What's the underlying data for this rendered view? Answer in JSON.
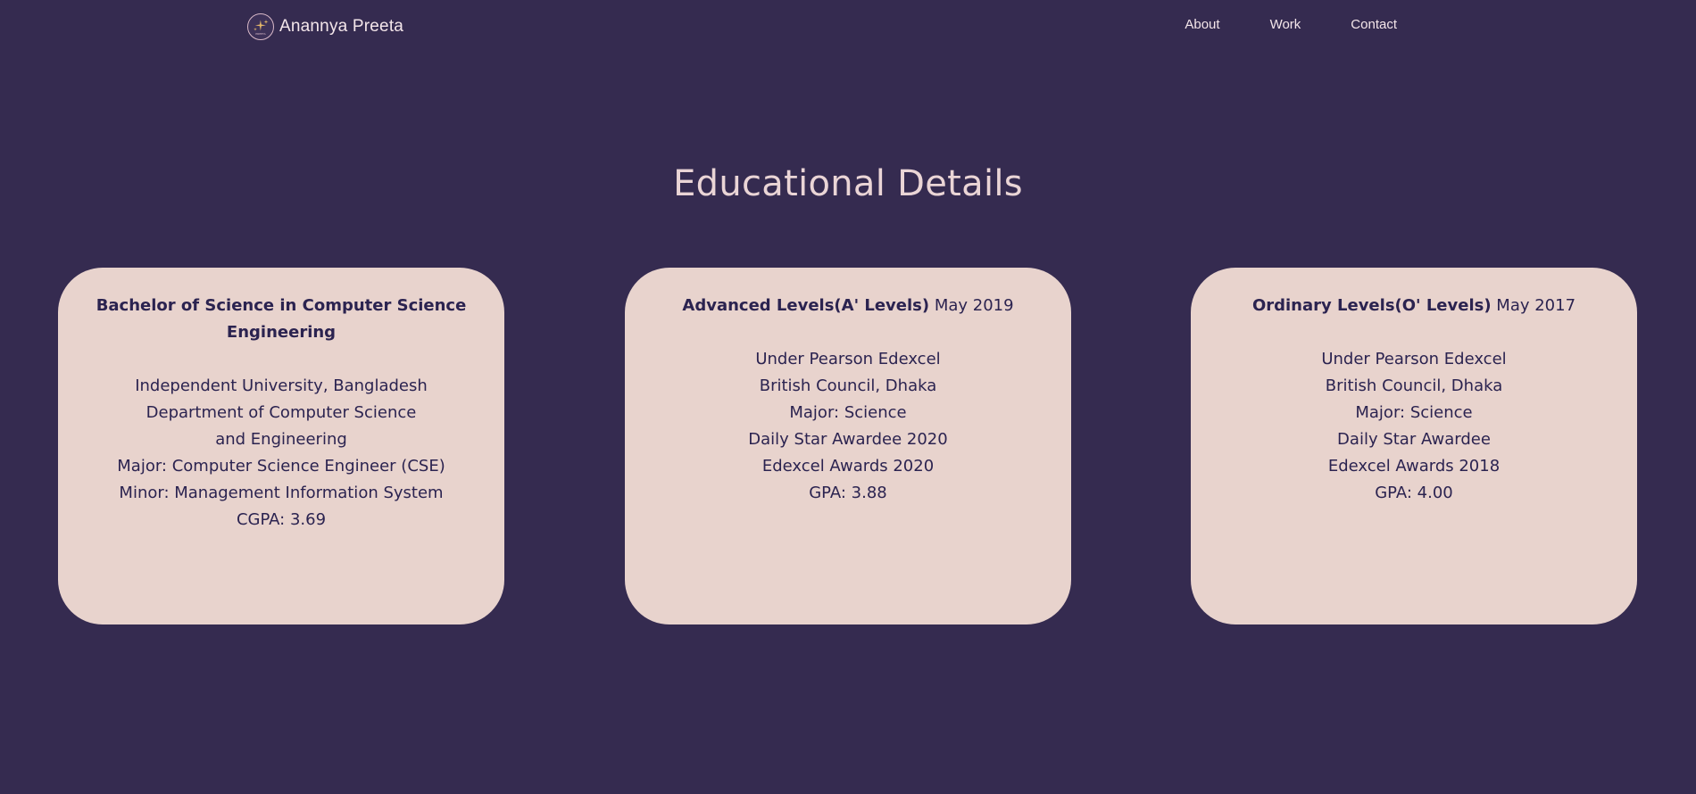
{
  "nav": {
    "brand_name": "Anannya Preeta",
    "logo_text": "PREETA",
    "links": [
      "About",
      "Work",
      "Contact"
    ]
  },
  "section": {
    "title": "Educational Details"
  },
  "cards": [
    {
      "title": "Bachelor of Science in Computer Science Engineering",
      "date": "",
      "lines": [
        "Independent University, Bangladesh",
        "Department of Computer Science",
        "and Engineering",
        "Major: Computer Science Engineer (CSE)",
        "Minor: Management Information System",
        "CGPA: 3.69"
      ]
    },
    {
      "title": "Advanced Levels(A' Levels)",
      "date": "May 2019",
      "lines": [
        "Under Pearson Edexcel",
        "British Council, Dhaka",
        "Major: Science",
        "Daily Star Awardee 2020",
        "Edexcel Awards 2020",
        "GPA: 3.88"
      ]
    },
    {
      "title": "Ordinary Levels(O' Levels)",
      "date": "May 2017",
      "lines": [
        "Under Pearson Edexcel",
        "British Council, Dhaka",
        "Major: Science",
        "Daily Star Awardee",
        "Edexcel Awards 2018",
        "GPA: 4.00"
      ]
    }
  ],
  "colors": {
    "background": "#352b50",
    "card_background": "#e8d3cd",
    "card_text": "#2b2350",
    "title_text": "#ead5d6",
    "nav_text": "#f4e6ea"
  }
}
